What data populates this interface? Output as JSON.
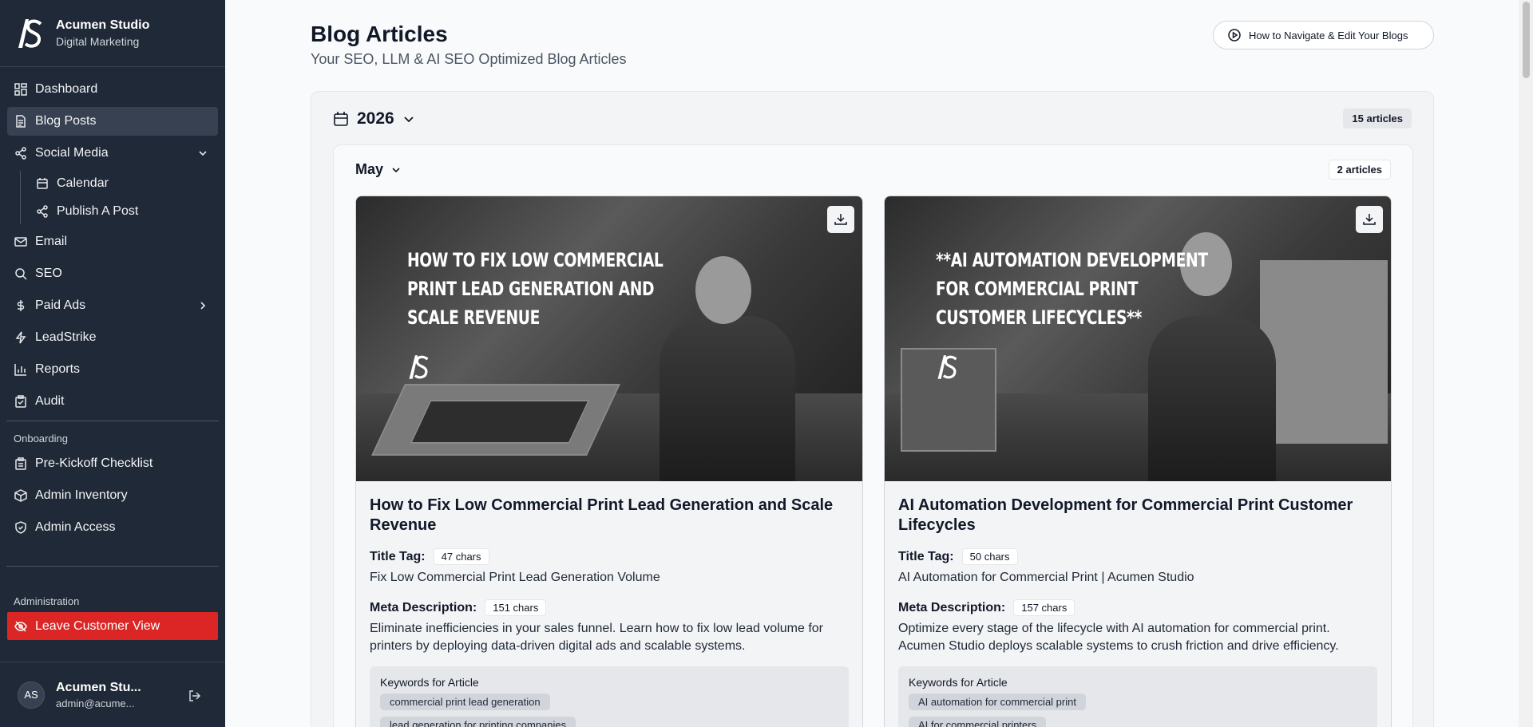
{
  "brand": {
    "name": "Acumen Studio",
    "subtitle": "Digital Marketing",
    "logo_text": "AS"
  },
  "nav": {
    "dashboard": "Dashboard",
    "blog_posts": "Blog Posts",
    "social_media": "Social Media",
    "calendar": "Calendar",
    "publish_post": "Publish A Post",
    "email": "Email",
    "seo": "SEO",
    "paid_ads": "Paid Ads",
    "leadstrike": "LeadStrike",
    "reports": "Reports",
    "audit": "Audit"
  },
  "onboarding": {
    "label": "Onboarding",
    "checklist": "Pre-Kickoff Checklist",
    "inventory": "Admin Inventory",
    "access": "Admin Access"
  },
  "administration": {
    "label": "Administration",
    "leave": "Leave Customer View"
  },
  "user": {
    "initials": "AS",
    "name": "Acumen Stu...",
    "email": "admin@acume..."
  },
  "page": {
    "title": "Blog Articles",
    "subtitle": "Your SEO, LLM & AI SEO Optimized Blog Articles",
    "help_button": "How to Navigate & Edit Your Blogs"
  },
  "year": {
    "label": "2026",
    "count": "15 articles"
  },
  "month": {
    "label": "May",
    "count": "2 articles"
  },
  "labels": {
    "title_tag": "Title Tag:",
    "meta_description": "Meta Description:",
    "keywords": "Keywords for Article"
  },
  "articles": [
    {
      "image_overlay": "HOW TO FIX LOW COMMERCIAL PRINT LEAD GENERATION AND SCALE REVENUE",
      "title": "How to Fix Low Commercial Print Lead Generation and Scale Revenue",
      "title_tag_chars": "47 chars",
      "title_tag": "Fix Low Commercial Print Lead Generation Volume",
      "meta_chars": "151 chars",
      "meta": "Eliminate inefficiencies in your sales funnel. Learn how to fix low lead volume for printers by deploying data-driven digital ads and scalable systems.",
      "keywords": [
        "commercial print lead generation",
        "lead generation for printing companies"
      ]
    },
    {
      "image_overlay": "**AI AUTOMATION DEVELOPMENT FOR COMMERCIAL PRINT CUSTOMER LIFECYCLES**",
      "title": "AI Automation Development for Commercial Print Customer Lifecycles",
      "title_tag_chars": "50 chars",
      "title_tag": "AI Automation for Commercial Print | Acumen Studio",
      "meta_chars": "157 chars",
      "meta": "Optimize every stage of the lifecycle with AI automation for commercial print. Acumen Studio deploys scalable systems to crush friction and drive efficiency.",
      "keywords": [
        "AI automation for commercial print",
        "AI for commercial printers"
      ]
    }
  ],
  "icons": {
    "logo": "as-monogram-logo",
    "dashboard": "grid-icon",
    "blog": "file-text-icon",
    "social": "share-icon",
    "calendar": "calendar-icon",
    "email": "mail-icon",
    "seo": "search-icon",
    "ads": "dollar-icon",
    "leadstrike": "zap-icon",
    "reports": "bar-chart-icon",
    "audit": "clipboard-check-icon",
    "download": "download-icon"
  },
  "colors": {
    "sidebar": "#1f2937",
    "active": "#374151",
    "danger": "#dc2626",
    "background": "#f9fafb"
  }
}
